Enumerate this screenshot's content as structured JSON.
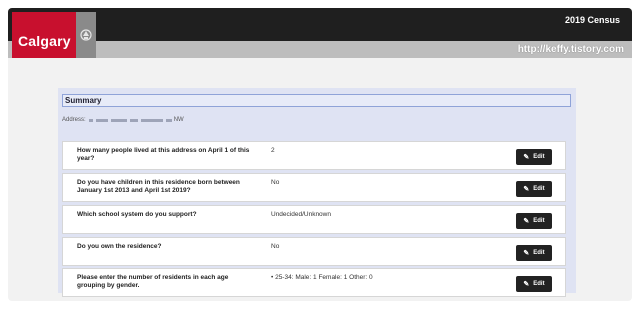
{
  "header": {
    "logo_text": "Calgary",
    "census_title": "2019 Census",
    "watermark": "http://keffy.tistory.com"
  },
  "summary": {
    "title": "Summary",
    "address_label": "Address:",
    "address_suffix": "NW"
  },
  "rows": [
    {
      "question": "How many people lived at this address on April 1 of this year?",
      "answer": "2",
      "edit_label": "Edit"
    },
    {
      "question": "Do you have children in this residence born between January 1st 2013 and April 1st 2019?",
      "answer": "No",
      "edit_label": "Edit"
    },
    {
      "question": "Which school system do you support?",
      "answer": "Undecided/Unknown",
      "edit_label": "Edit"
    },
    {
      "question": "Do you own the residence?",
      "answer": "No",
      "edit_label": "Edit"
    },
    {
      "question": "Please enter the number of residents in each age grouping by gender.",
      "answer": "• 25-34: Male: 1 Female: 1 Other: 0",
      "edit_label": "Edit"
    }
  ]
}
